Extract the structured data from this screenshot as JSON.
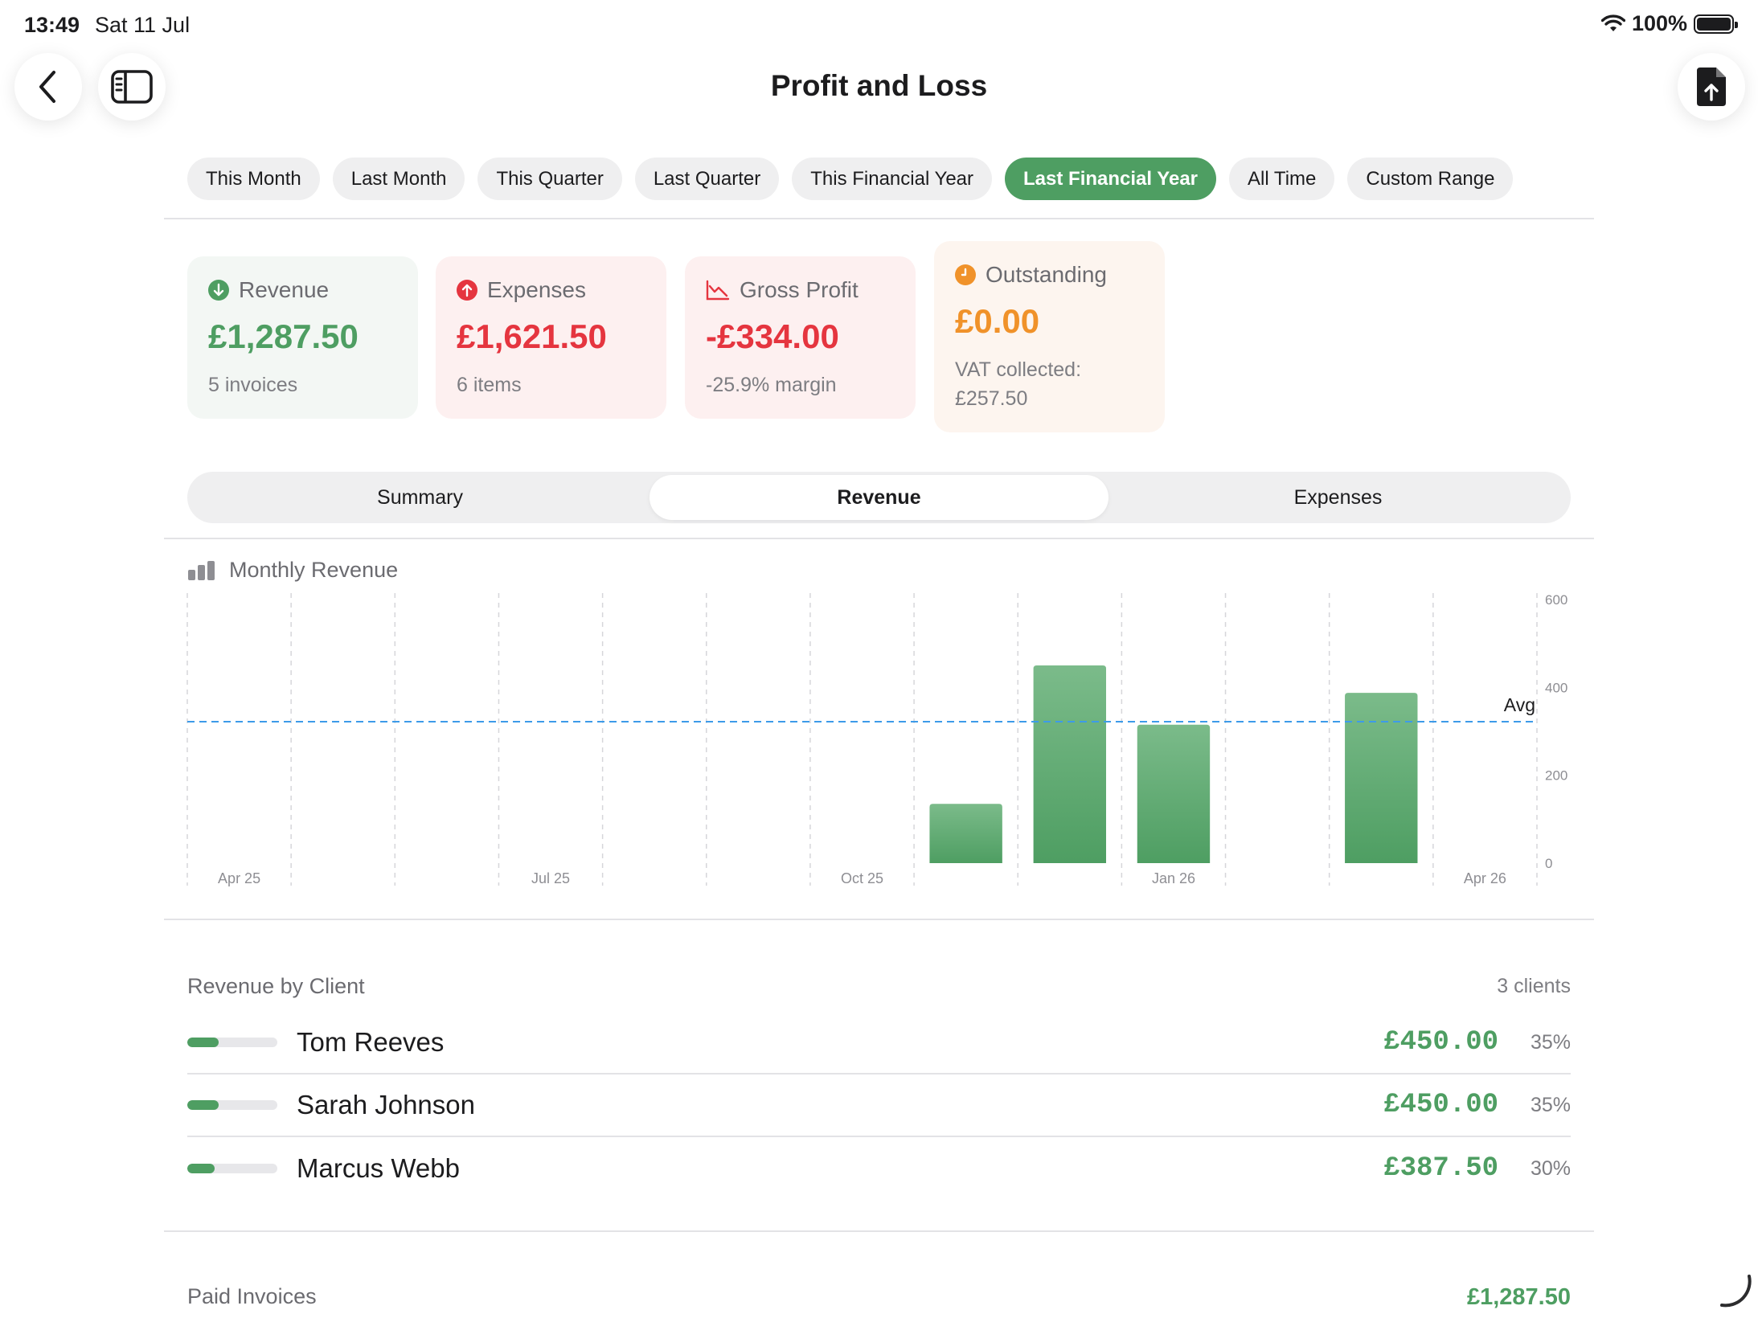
{
  "status": {
    "time": "13:49",
    "date": "Sat 11 Jul",
    "battery": "100%"
  },
  "header": {
    "title": "Profit and Loss"
  },
  "filters": [
    {
      "label": "This Month",
      "active": false
    },
    {
      "label": "Last Month",
      "active": false
    },
    {
      "label": "This Quarter",
      "active": false
    },
    {
      "label": "Last Quarter",
      "active": false
    },
    {
      "label": "This Financial Year",
      "active": false
    },
    {
      "label": "Last Financial Year",
      "active": true
    },
    {
      "label": "All Time",
      "active": false
    },
    {
      "label": "Custom Range",
      "active": false
    }
  ],
  "cards": {
    "revenue": {
      "title": "Revenue",
      "value": "£1,287.50",
      "sub": "5 invoices"
    },
    "expenses": {
      "title": "Expenses",
      "value": "£1,621.50",
      "sub": "6 items"
    },
    "gross_profit": {
      "title": "Gross Profit",
      "value": "-£334.00",
      "sub": "-25.9% margin"
    },
    "outstanding": {
      "title": "Outstanding",
      "value": "£0.00",
      "sub_line1": "VAT collected:",
      "sub_line2": "£257.50"
    }
  },
  "tabs": [
    {
      "label": "Summary",
      "active": false
    },
    {
      "label": "Revenue",
      "active": true
    },
    {
      "label": "Expenses",
      "active": false
    }
  ],
  "chart_title": "Monthly Revenue",
  "chart_data": {
    "type": "bar",
    "title": "Monthly Revenue",
    "categories": [
      "Apr 25",
      "May 25",
      "Jun 25",
      "Jul 25",
      "Aug 25",
      "Sep 25",
      "Oct 25",
      "Nov 25",
      "Dec 25",
      "Jan 26",
      "Feb 26",
      "Mar 26",
      "Apr 26"
    ],
    "x_tick_labels": [
      "Apr 25",
      "Jul 25",
      "Oct 25",
      "Jan 26",
      "Apr 26"
    ],
    "values": [
      0,
      0,
      0,
      0,
      0,
      0,
      0,
      135,
      450,
      315,
      0,
      387.5,
      0
    ],
    "ylim": [
      0,
      600
    ],
    "y_ticks": [
      "0",
      "200",
      "400",
      "600"
    ],
    "average": 322,
    "average_label": "Avg",
    "grid": true,
    "bar_color": "#4e9e62",
    "avg_line_color": "#3d9be9"
  },
  "revenue_by_client": {
    "title": "Revenue by Client",
    "count": "3 clients",
    "rows": [
      {
        "name": "Tom Reeves",
        "amount": "£450.00",
        "percent": "35%",
        "share": 0.35
      },
      {
        "name": "Sarah Johnson",
        "amount": "£450.00",
        "percent": "35%",
        "share": 0.35
      },
      {
        "name": "Marcus Webb",
        "amount": "£387.50",
        "percent": "30%",
        "share": 0.3
      }
    ]
  },
  "paid_invoices": {
    "title": "Paid Invoices",
    "total": "£1,287.50"
  },
  "colors": {
    "accent": "#4e9e62",
    "danger": "#e5353f",
    "warning": "#f0922a"
  }
}
